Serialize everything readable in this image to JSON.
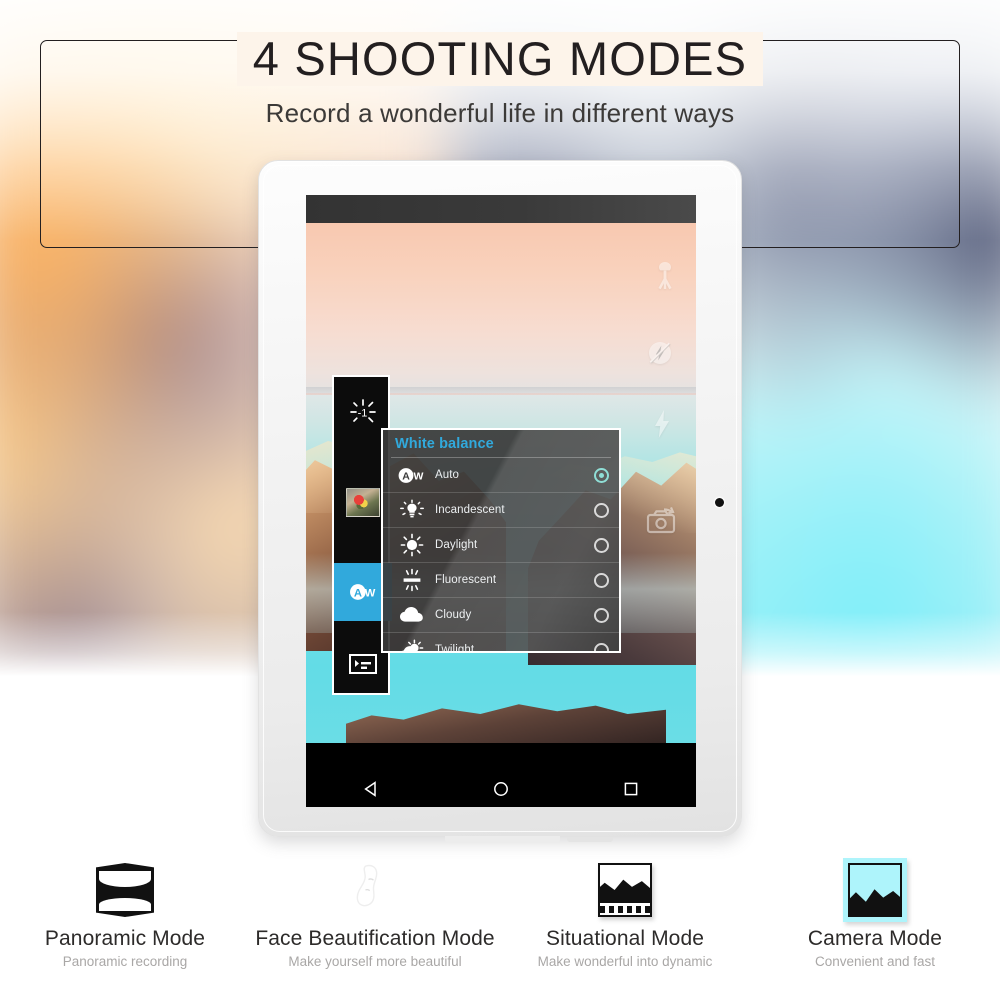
{
  "header": {
    "title": "4 SHOOTING MODES",
    "subtitle": "Record a wonderful life in different ways"
  },
  "device": {
    "type": "tablet",
    "camera_dot": "front-camera-lens",
    "navbar": {
      "back": "back-icon",
      "home": "home-icon",
      "recents": "recents-icon"
    }
  },
  "camera_app": {
    "statusbar": "",
    "left_rail": [
      {
        "name": "exposure-compensation-icon",
        "label": "-1",
        "active": false
      },
      {
        "name": "scene-mode-thumbnail-icon",
        "label": "",
        "active": false
      },
      {
        "name": "white-balance-auto-icon",
        "label": "AW",
        "active": true
      },
      {
        "name": "picture-size-icon",
        "label": "",
        "active": false
      }
    ],
    "overlay_icons": [
      "tripod-icon",
      "no-flash-icon",
      "flash-icon",
      "switch-camera-icon"
    ],
    "bottom_controls": {
      "video_label": "video-record-icon",
      "shutter_label": "shutter-icon",
      "settings_label": "gear-icon",
      "gallery_label": "gallery-thumbnail"
    },
    "white_balance_dialog": {
      "title": "White balance",
      "title_color": "#31a9dc",
      "selected_color": "#7fdad0",
      "options": [
        {
          "label": "Auto",
          "icon": "auto-wb-icon",
          "selected": true
        },
        {
          "label": "Incandescent",
          "icon": "bulb-icon",
          "selected": false
        },
        {
          "label": "Daylight",
          "icon": "sun-icon",
          "selected": false
        },
        {
          "label": "Fluorescent",
          "icon": "fluorescent-icon",
          "selected": false
        },
        {
          "label": "Cloudy",
          "icon": "cloud-icon",
          "selected": false
        },
        {
          "label": "Twilight",
          "icon": "twilight-icon",
          "selected": false
        }
      ]
    }
  },
  "modes": [
    {
      "title": "Panoramic Mode",
      "subtitle": "Panoramic recording",
      "icon": "panorama-icon",
      "highlight": false
    },
    {
      "title": "Face Beautification Mode",
      "subtitle": "Make yourself more beautiful",
      "icon": "face-beautify-icon",
      "highlight": false
    },
    {
      "title": "Situational Mode",
      "subtitle": "Make wonderful into dynamic",
      "icon": "situational-film-icon",
      "highlight": false
    },
    {
      "title": "Camera Mode",
      "subtitle": "Convenient and fast",
      "icon": "camera-photo-icon",
      "highlight": true
    }
  ],
  "colors": {
    "accent_blue": "#31a9dc",
    "highlight_cyan": "#aef4fb",
    "text_dark": "#2d2b2a",
    "text_muted": "#a9a7a6"
  }
}
